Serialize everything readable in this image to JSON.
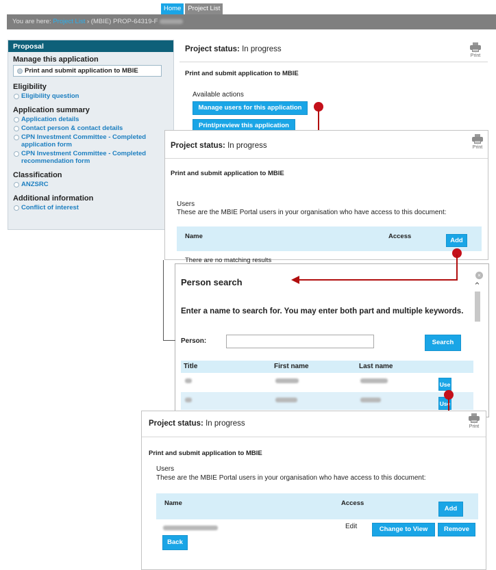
{
  "tabs": [
    "Home",
    "Project List"
  ],
  "breadcrumb": {
    "prefix": "You are here:",
    "link": "Project List",
    "rest": "› (MBIE) PROP-64319-F"
  },
  "sidebar": {
    "header": "Proposal",
    "groups": [
      {
        "title": "Manage this application",
        "items": [
          "Print and submit application to MBIE"
        ]
      },
      {
        "title": "Eligibility",
        "items": [
          "Eligibility question"
        ]
      },
      {
        "title": "Application summary",
        "items": [
          "Application details",
          "Contact person & contact details",
          "CPN Investment Committee - Completed application form",
          "CPN Investment Committee - Completed recommendation form"
        ]
      },
      {
        "title": "Classification",
        "items": [
          "ANZSRC"
        ]
      },
      {
        "title": "Additional information",
        "items": [
          "Conflict of interest"
        ]
      }
    ]
  },
  "panel1": {
    "status_label": "Project status:",
    "status_value": "In progress",
    "print_label": "Print",
    "title": "Print and submit application to MBIE",
    "actions_label": "Available actions",
    "btn_manage": "Manage users for this application",
    "btn_preview": "Print/preview this application"
  },
  "panel2": {
    "status_label": "Project status:",
    "status_value": "In progress",
    "print_label": "Print",
    "title": "Print and submit application to MBIE",
    "users_label": "Users",
    "users_desc": "These are the MBIE Portal users in your organisation who have access to this document:",
    "col_name": "Name",
    "col_access": "Access",
    "add_label": "Add",
    "empty": "There are no matching results"
  },
  "search": {
    "title": "Person search",
    "instructions": "Enter a name to search for. You may enter both part and multiple keywords.",
    "person_label": "Person:",
    "person_value": "",
    "search_button": "Search",
    "col_title": "Title",
    "col_first": "First name",
    "col_last": "Last name",
    "use_label": "Use"
  },
  "panel3": {
    "status_label": "Project status:",
    "status_value": "In progress",
    "print_label": "Print",
    "title": "Print and submit application to MBIE",
    "users_label": "Users",
    "users_desc": "These are the MBIE Portal users in your organisation who have access to this document:",
    "col_name": "Name",
    "col_access": "Access",
    "add_label": "Add",
    "row_access": "Edit",
    "btn_change": "Change to View",
    "btn_remove": "Remove",
    "btn_back": "Back"
  },
  "colors": {
    "accent": "#1aa5e6",
    "sidebar_header": "#0e6079",
    "arrow": "#b10e0e"
  }
}
